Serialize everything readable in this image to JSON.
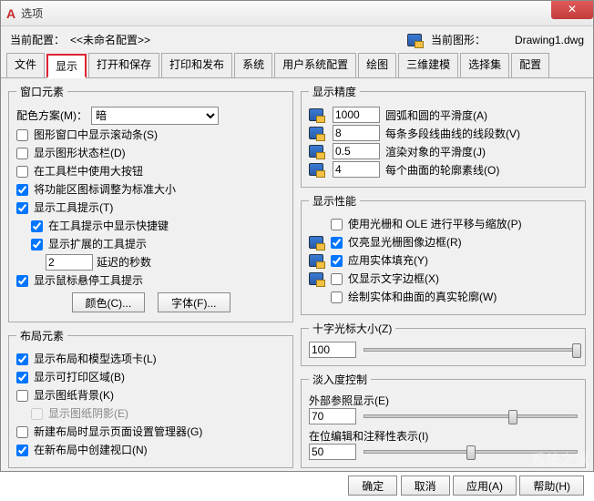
{
  "window": {
    "title": "选项"
  },
  "header": {
    "currentProfileLabel": "当前配置：",
    "currentProfileValue": "<<未命名配置>>",
    "currentDrawingLabel": "当前图形：",
    "currentDrawingValue": "Drawing1.dwg"
  },
  "tabs": [
    "文件",
    "显示",
    "打开和保存",
    "打印和发布",
    "系统",
    "用户系统配置",
    "绘图",
    "三维建模",
    "选择集",
    "配置"
  ],
  "activeTab": "显示",
  "windowElements": {
    "legend": "窗口元素",
    "colorSchemeLabel": "配色方案(M)：",
    "colorSchemeValue": "暗",
    "items": [
      {
        "label": "图形窗口中显示滚动条(S)",
        "checked": false
      },
      {
        "label": "显示图形状态栏(D)",
        "checked": false
      },
      {
        "label": "在工具栏中使用大按钮",
        "checked": false
      },
      {
        "label": "将功能区图标调整为标准大小",
        "checked": true
      },
      {
        "label": "显示工具提示(T)",
        "checked": true
      }
    ],
    "sub": [
      {
        "label": "在工具提示中显示快捷键",
        "checked": true
      },
      {
        "label": "显示扩展的工具提示",
        "checked": true
      }
    ],
    "delayLabel": "延迟的秒数",
    "delayValue": "2",
    "hoverTip": {
      "label": "显示鼠标悬停工具提示",
      "checked": true
    },
    "colorBtn": "颜色(C)...",
    "fontBtn": "字体(F)..."
  },
  "layoutElements": {
    "legend": "布局元素",
    "items": [
      {
        "label": "显示布局和模型选项卡(L)",
        "checked": true
      },
      {
        "label": "显示可打印区域(B)",
        "checked": true
      },
      {
        "label": "显示图纸背景(K)",
        "checked": false
      }
    ],
    "shadow": {
      "label": "显示图纸阴影(E)",
      "checked": false
    },
    "items2": [
      {
        "label": "新建布局时显示页面设置管理器(G)",
        "checked": false
      },
      {
        "label": "在新布局中创建视口(N)",
        "checked": true
      }
    ]
  },
  "precision": {
    "legend": "显示精度",
    "rows": [
      {
        "value": "1000",
        "label": "圆弧和圆的平滑度(A)"
      },
      {
        "value": "8",
        "label": "每条多段线曲线的线段数(V)"
      },
      {
        "value": "0.5",
        "label": "渲染对象的平滑度(J)"
      },
      {
        "value": "4",
        "label": "每个曲面的轮廓素线(O)"
      }
    ]
  },
  "perf": {
    "legend": "显示性能",
    "items": [
      {
        "label": "使用光栅和 OLE 进行平移与缩放(P)",
        "checked": false,
        "db": false
      },
      {
        "label": "仅亮显光栅图像边框(R)",
        "checked": true,
        "db": true
      },
      {
        "label": "应用实体填充(Y)",
        "checked": true,
        "db": true
      },
      {
        "label": "仅显示文字边框(X)",
        "checked": false,
        "db": true
      },
      {
        "label": "绘制实体和曲面的真实轮廓(W)",
        "checked": false,
        "db": false
      }
    ]
  },
  "crosshair": {
    "legend": "十字光标大小(Z)",
    "value": "100",
    "thumbPct": 98
  },
  "fade": {
    "legend": "淡入度控制",
    "xrefLabel": "外部参照显示(E)",
    "xrefValue": "70",
    "xrefThumbPct": 68,
    "editLabel": "在位编辑和注释性表示(I)",
    "editValue": "50",
    "editThumbPct": 48
  },
  "buttons": {
    "ok": "确定",
    "cancel": "取消",
    "apply": "应用(A)",
    "help": "帮助(H)"
  }
}
